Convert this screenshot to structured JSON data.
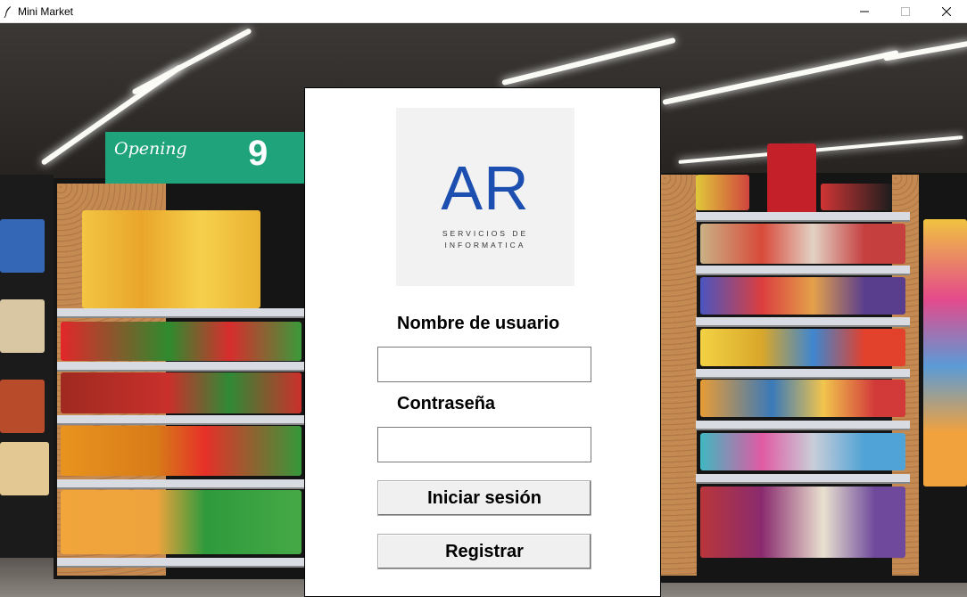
{
  "window": {
    "title": "Mini Market",
    "app_icon": "feather-icon",
    "controls": [
      "minimize-icon",
      "maximize-icon",
      "close-icon"
    ]
  },
  "background": {
    "banner_text": "Opening",
    "banner_number": "9"
  },
  "logo": {
    "letters": "AR",
    "line1": "SERVICIOS DE",
    "line2": "INFORMATICA",
    "color": "#1c4fb0"
  },
  "form": {
    "username_label": "Nombre de usuario",
    "username_value": "",
    "password_label": "Contraseña",
    "password_value": "",
    "login_button": "Iniciar sesión",
    "register_button": "Registrar"
  }
}
